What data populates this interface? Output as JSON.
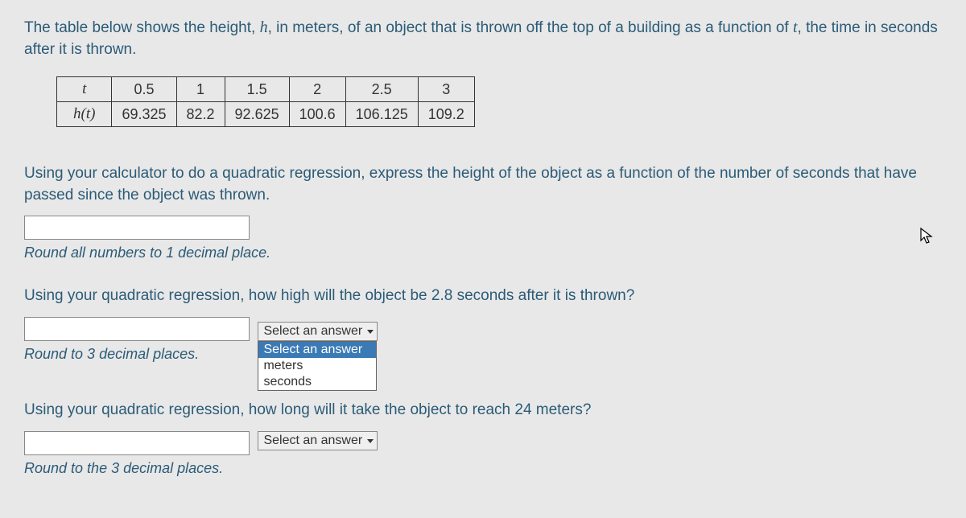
{
  "intro": {
    "part1": "The table below shows the height, ",
    "var_h": "h",
    "part2": ", in meters, of an object that is thrown off the top of a building as a function of ",
    "var_t": "t",
    "part3": ", the time in seconds after it is thrown."
  },
  "table": {
    "row1_header": "t",
    "row1": [
      "0.5",
      "1",
      "1.5",
      "2",
      "2.5",
      "3"
    ],
    "row2_header": "h(t)",
    "row2": [
      "69.325",
      "82.2",
      "92.625",
      "100.6",
      "106.125",
      "109.2"
    ]
  },
  "q1": {
    "text": "Using your calculator to do a quadratic regression, express the height of the object as a function of the number of seconds that have passed since the object was thrown.",
    "hint": "Round all numbers to 1 decimal place."
  },
  "q2": {
    "text": "Using your quadratic regression, how high will the object be 2.8 seconds after it is thrown?",
    "select_placeholder": "Select an answer",
    "hint": "Round to 3 decimal places.",
    "options": {
      "opt0": "Select an answer",
      "opt1": "meters",
      "opt2": "seconds"
    }
  },
  "q3": {
    "text": "Using your quadratic regression, how long will it take the object to reach 24 meters?",
    "select_placeholder": "Select an answer",
    "hint": "Round to the 3 decimal places."
  }
}
